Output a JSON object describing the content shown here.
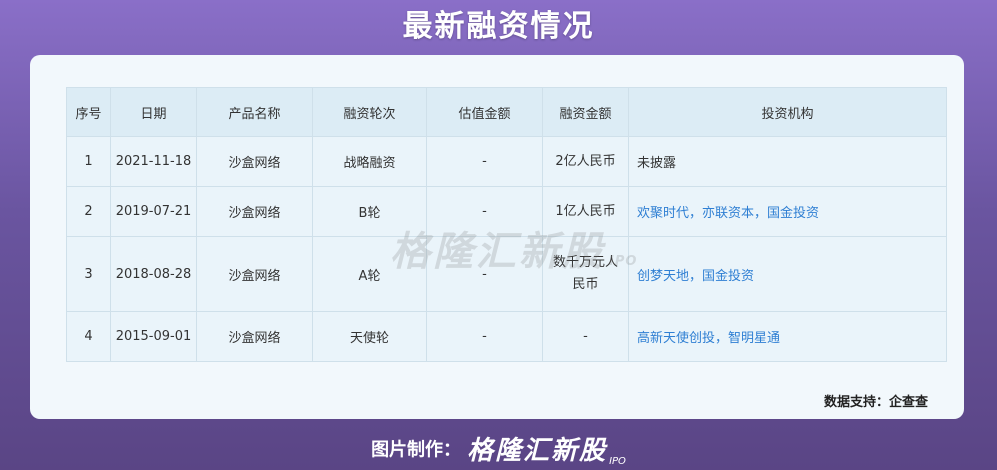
{
  "page_title": "最新融资情况",
  "table": {
    "headers": [
      "序号",
      "日期",
      "产品名称",
      "融资轮次",
      "估值金额",
      "融资金额",
      "投资机构"
    ],
    "rows": [
      {
        "no": "1",
        "date": "2021-11-18",
        "product": "沙盒网络",
        "round": "战略融资",
        "valuation": "-",
        "amount": "2亿人民币",
        "investors": "未披露"
      },
      {
        "no": "2",
        "date": "2019-07-21",
        "product": "沙盒网络",
        "round": "B轮",
        "valuation": "-",
        "amount": "1亿人民币",
        "investors": "欢聚时代，亦联资本，国金投资"
      },
      {
        "no": "3",
        "date": "2018-08-28",
        "product": "沙盒网络",
        "round": "A轮",
        "valuation": "-",
        "amount": "数千万元人民币",
        "investors": "创梦天地，国金投资"
      },
      {
        "no": "4",
        "date": "2015-09-01",
        "product": "沙盒网络",
        "round": "天使轮",
        "valuation": "-",
        "amount": "-",
        "investors": "高新天使创投，智明星通"
      }
    ]
  },
  "watermark": {
    "text": "格隆汇新股",
    "sub": "IPO"
  },
  "source_note": "数据支持：企查查",
  "footer": {
    "label": "图片制作：",
    "brand": "格隆汇新股",
    "brand_sub": "IPO"
  }
}
